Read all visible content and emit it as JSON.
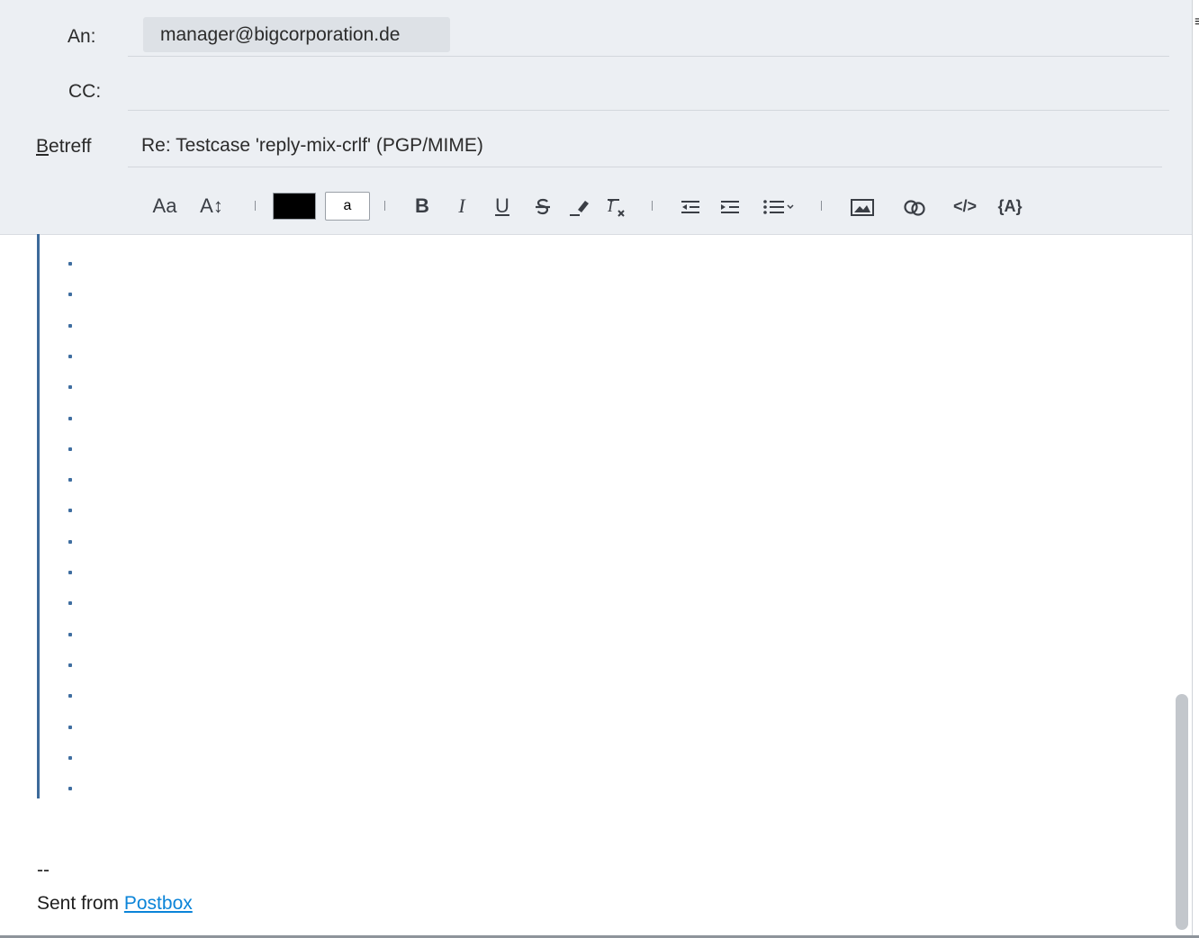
{
  "header": {
    "to_label": "An:",
    "cc_label": "CC:",
    "subject_label_first": "B",
    "subject_label_rest": "etreff",
    "recipient": "manager@bigcorporation.de",
    "subject": "Re: Testcase 'reply-mix-crlf' (PGP/MIME)"
  },
  "toolbar": {
    "font_label": "Aa",
    "size_label": "A↕",
    "text_color": "#000000",
    "bg_color_label": "a",
    "bold_label": "B",
    "italic_label": "I",
    "underline_label": "U",
    "code_label": "</>",
    "variable_label": "{A}"
  },
  "body": {
    "quote_dot_count": 18,
    "signature_dash": "--",
    "sent_from_prefix": "Sent from ",
    "sent_from_link": "Postbox"
  },
  "colors": {
    "header_bg": "#eceff3",
    "quote_bar": "#3d6a9a",
    "link": "#0b84d8"
  }
}
